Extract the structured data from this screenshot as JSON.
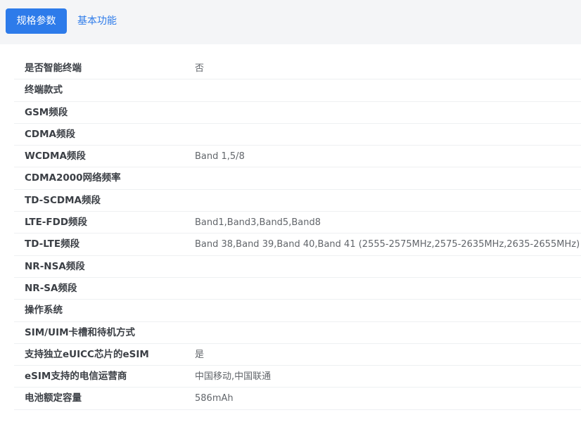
{
  "tabs": {
    "specs_label": "规格参数",
    "features_label": "基本功能"
  },
  "colors": {
    "accent": "#2d7bea",
    "topbar_bg": "#f4f5f7",
    "label_text": "#3b3f45",
    "value_text": "#62666b"
  },
  "specs": [
    {
      "label": "是否智能终端",
      "value": "否"
    },
    {
      "label": "终端款式",
      "value": ""
    },
    {
      "label": "GSM频段",
      "value": ""
    },
    {
      "label": "CDMA频段",
      "value": ""
    },
    {
      "label": "WCDMA频段",
      "value": "Band 1,5/8"
    },
    {
      "label": "CDMA2000网络频率",
      "value": ""
    },
    {
      "label": "TD-SCDMA频段",
      "value": ""
    },
    {
      "label": "LTE-FDD频段",
      "value": "Band1,Band3,Band5,Band8"
    },
    {
      "label": "TD-LTE频段",
      "value": "Band 38,Band 39,Band 40,Band 41 (2555-2575MHz,2575-2635MHz,2635-2655MHz)"
    },
    {
      "label": "NR-NSA频段",
      "value": ""
    },
    {
      "label": "NR-SA频段",
      "value": ""
    },
    {
      "label": "操作系统",
      "value": ""
    },
    {
      "label": "SIM/UIM卡槽和待机方式",
      "value": ""
    },
    {
      "label": "支持独立eUICC芯片的eSIM",
      "value": "是"
    },
    {
      "label": "eSIM支持的电信运营商",
      "value": "中国移动,中国联通"
    },
    {
      "label": "电池额定容量",
      "value": "586mAh"
    }
  ]
}
